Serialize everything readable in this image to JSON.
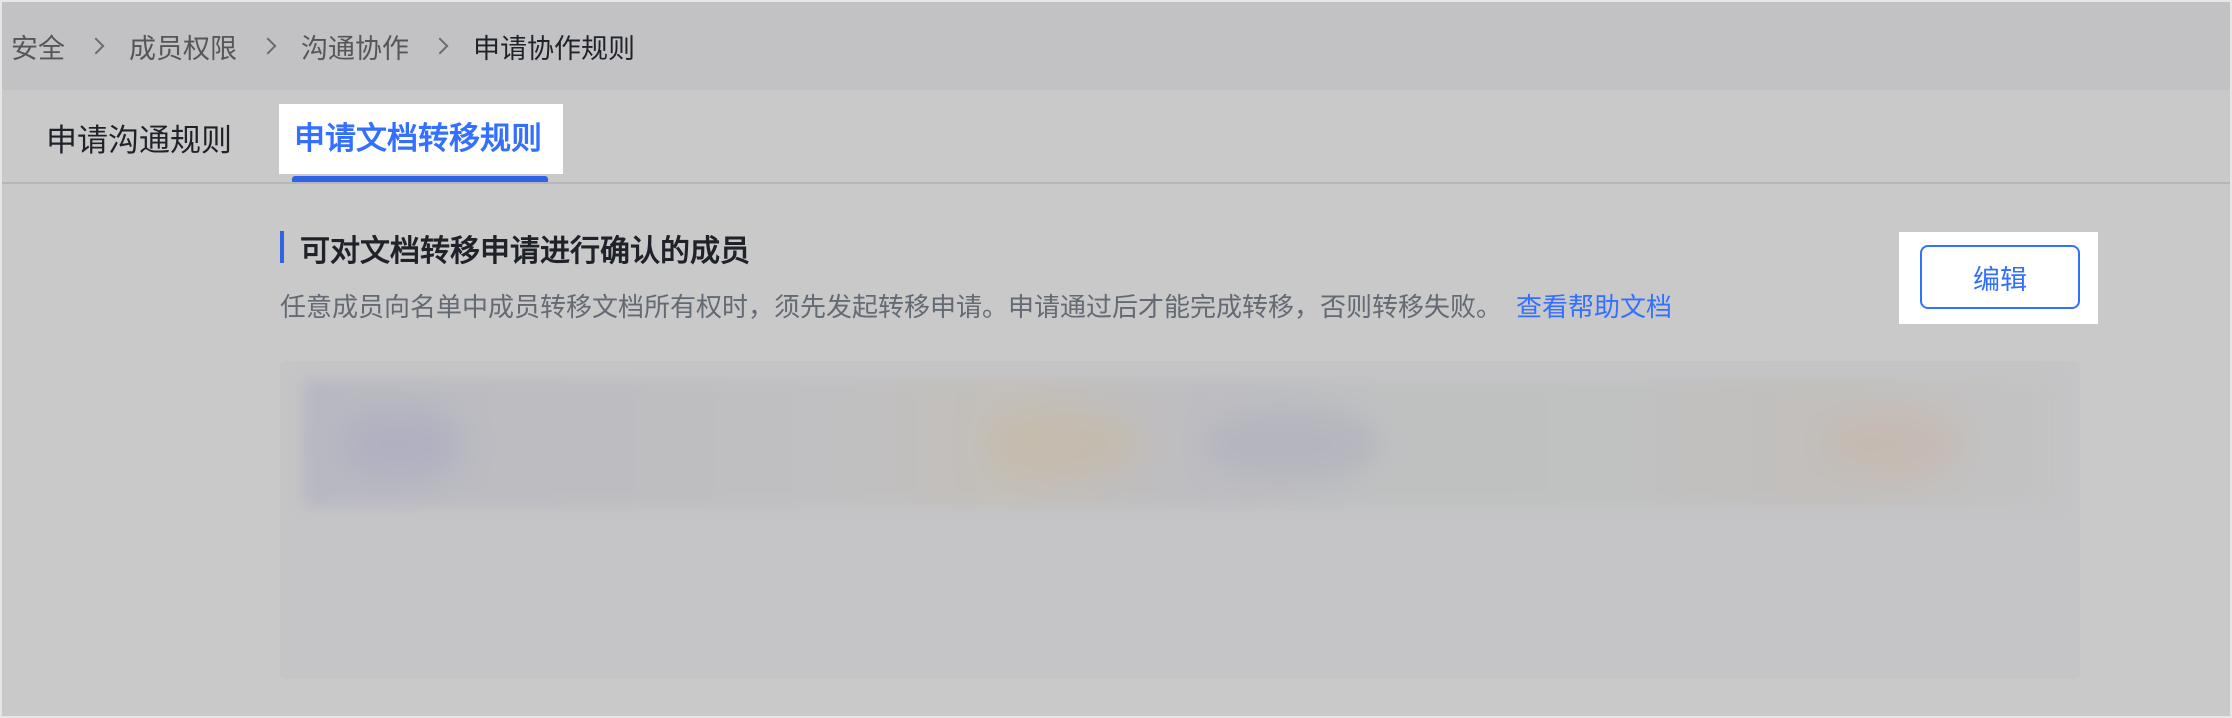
{
  "breadcrumb": {
    "items": [
      "安全",
      "成员权限",
      "沟通协作",
      "申请协作规则"
    ]
  },
  "tabs": [
    {
      "label": "申请沟通规则",
      "active": false
    },
    {
      "label": "申请文档转移规则",
      "active": true
    }
  ],
  "section": {
    "title": "可对文档转移申请进行确认的成员",
    "description": "任意成员向名单中成员转移文档所有权时，须先发起转移申请。申请通过后才能完成转移，否则转移失败。",
    "help_link": "查看帮助文档",
    "edit_label": "编辑"
  },
  "colors": {
    "accent": "#3370ff",
    "text_primary": "#1f2329",
    "text_secondary": "#646a73"
  },
  "icons": {
    "breadcrumb_separator": "chevron-right-icon"
  }
}
